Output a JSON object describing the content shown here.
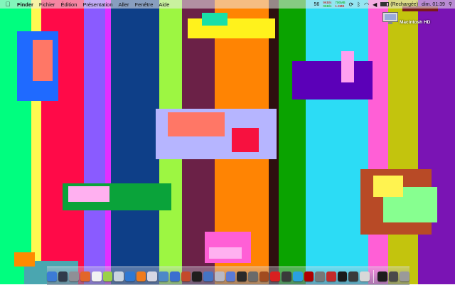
{
  "menubar": {
    "apple_icon": "apple-icon",
    "items": [
      "Finder",
      "Fichier",
      "Édition",
      "Présentation",
      "Aller",
      "Fenêtre",
      "Aide"
    ],
    "status": {
      "cpu_percent": "56",
      "net_up": "9KB/s",
      "net_down": "0KB/s",
      "mem_free": "706MB",
      "mem_used": "1.3MB",
      "battery_fill_percent": 80,
      "battery_text": "(Rechargée)",
      "clock": "dim. 01:39"
    }
  },
  "desktop": {
    "hd_label": "Macintosh HD"
  },
  "dock": {
    "icons": [
      {
        "name": "finder-icon",
        "color": "#3c7bd6"
      },
      {
        "name": "dashboard-icon",
        "color": "#303a4a"
      },
      {
        "name": "system-preferences-icon",
        "color": "#8f8f96"
      },
      {
        "name": "firefox-icon",
        "color": "#e2662a"
      },
      {
        "name": "adium-icon",
        "color": "#f2f2f2"
      },
      {
        "name": "itunes-icon",
        "color": "#9ad14a"
      },
      {
        "name": "address-book-icon",
        "color": "#c9d4e0"
      },
      {
        "name": "internet-explorer-icon",
        "color": "#2f78d2"
      },
      {
        "name": "vlc-icon",
        "color": "#f07b1c"
      },
      {
        "name": "app-icon-10",
        "color": "#d7d7e4"
      },
      {
        "name": "app-icon-11",
        "color": "#4d88c8"
      },
      {
        "name": "app-icon-12",
        "color": "#3a6fd0"
      },
      {
        "name": "transmission-icon",
        "color": "#c44a2a"
      },
      {
        "name": "terminal-icon",
        "color": "#1e1e1e"
      },
      {
        "name": "app-icon-15",
        "color": "#4474c4"
      },
      {
        "name": "app-icon-16",
        "color": "#b8b8c4"
      },
      {
        "name": "mail-icon",
        "color": "#5a7ad6"
      },
      {
        "name": "app-icon-18",
        "color": "#2a2a2a"
      },
      {
        "name": "app-icon-19",
        "color": "#6a6a6a"
      },
      {
        "name": "app-icon-20",
        "color": "#a14b1f"
      },
      {
        "name": "app-icon-21",
        "color": "#d92020"
      },
      {
        "name": "app-icon-22",
        "color": "#3a3a3a"
      },
      {
        "name": "app-icon-23",
        "color": "#2aa0e0"
      },
      {
        "name": "app-icon-24",
        "color": "#b00000"
      },
      {
        "name": "app-icon-25",
        "color": "#777777"
      },
      {
        "name": "app-icon-26",
        "color": "#c32a2a"
      },
      {
        "name": "app-icon-27",
        "color": "#1a1a1a"
      },
      {
        "name": "app-icon-28",
        "color": "#3a3a3a"
      },
      {
        "name": "app-icon-29",
        "color": "#d8d8d8"
      }
    ],
    "right_icons": [
      {
        "name": "app-icon-30",
        "color": "#1d1d1d"
      },
      {
        "name": "downloads-icon",
        "color": "#4a4a4a"
      },
      {
        "name": "trash-icon",
        "color": "#9a9a9a"
      }
    ]
  },
  "wallpaper": {
    "stripes": [
      {
        "color": "#00fe7f"
      },
      {
        "color": "#fff950"
      },
      {
        "color": "#ff0a48"
      },
      {
        "color": "#8a5bff"
      },
      {
        "color": "#e22fff"
      },
      {
        "color": "#0e3f88"
      },
      {
        "color": "#9df642"
      },
      {
        "color": "#6b2147"
      },
      {
        "color": "#ff8403"
      },
      {
        "color": "#2e0f0f"
      },
      {
        "color": "#0aa300"
      },
      {
        "color": "#2cdcf5"
      },
      {
        "color": "#ff5fd6"
      },
      {
        "color": "#c3c40d"
      },
      {
        "color": "#7a14b4"
      }
    ]
  }
}
